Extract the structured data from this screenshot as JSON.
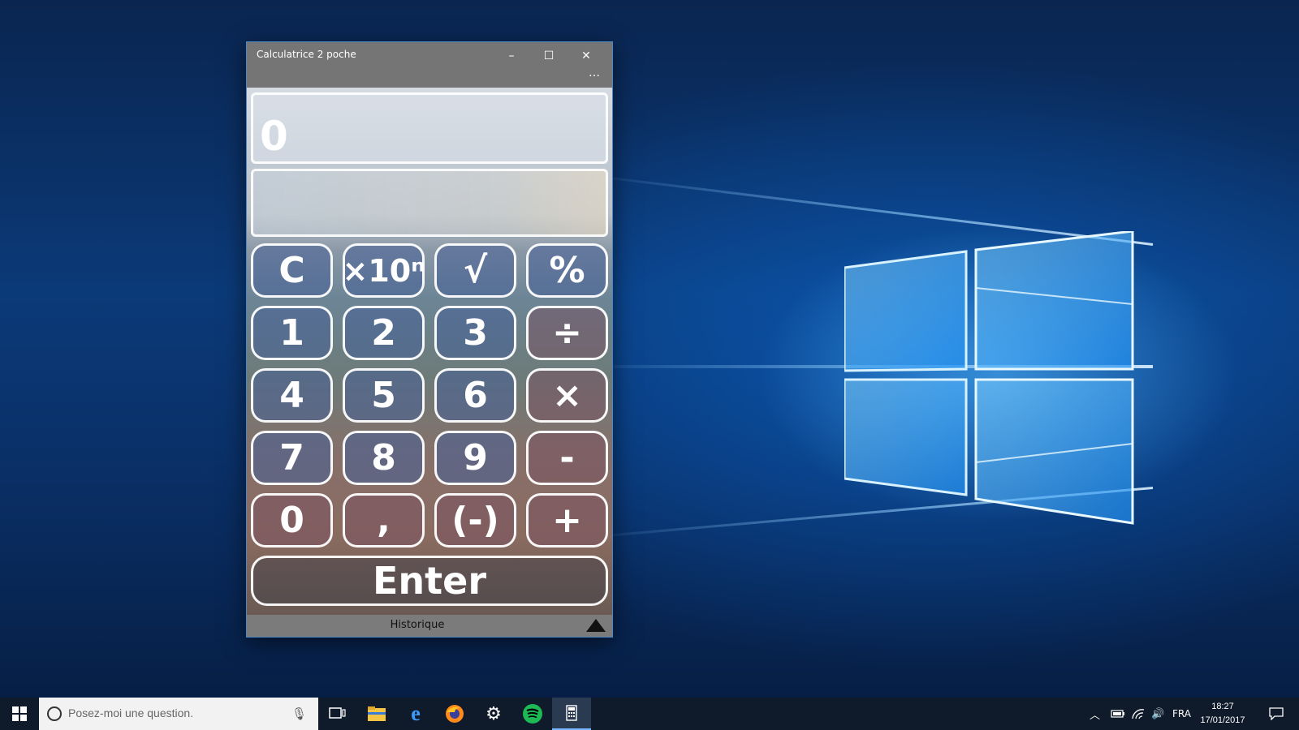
{
  "window": {
    "title": "Calculatrice 2 poche",
    "minimize_glyph": "–",
    "maximize_glyph": "☐",
    "close_glyph": "✕",
    "more_glyph": "…"
  },
  "display": {
    "value": "0",
    "secondary": ""
  },
  "keys": {
    "clear": "C",
    "exp": "×10ⁿ",
    "sqrt": "√",
    "percent": "%",
    "one": "1",
    "two": "2",
    "three": "3",
    "divide": "÷",
    "four": "4",
    "five": "5",
    "six": "6",
    "multiply": "×",
    "seven": "7",
    "eight": "8",
    "nine": "9",
    "minus": "-",
    "zero": "0",
    "comma": ",",
    "negate": "(-)",
    "plus": "+",
    "enter": "Enter"
  },
  "history": {
    "label": "Historique"
  },
  "taskbar": {
    "search_placeholder": "Posez-moi une question.",
    "icons": [
      "windows-start-icon",
      "task-view-icon",
      "file-explorer-icon",
      "edge-icon",
      "firefox-icon",
      "settings-icon",
      "spotify-icon",
      "calculator-icon"
    ],
    "language": "FRA",
    "time": "18:27",
    "date": "17/01/2017"
  },
  "colors": {
    "accent": "#4a88c7",
    "taskbar": "#0f1a2a",
    "spotify": "#1db954"
  }
}
